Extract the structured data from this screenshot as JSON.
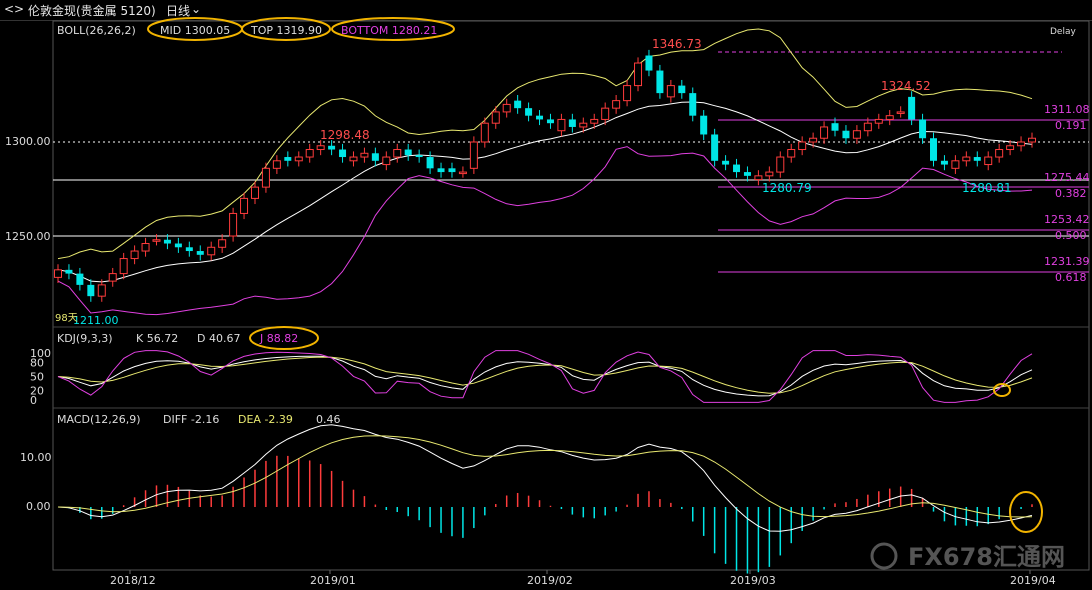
{
  "titlebar": {
    "symbol": "伦敦金现(贵金属 5120)",
    "period": "日线",
    "back_arrows": "<>",
    "delay": "Delay"
  },
  "boll": {
    "name": "BOLL(26,26,2)",
    "mid_label": "MID 1300.05",
    "top_label": "TOP 1319.90",
    "bottom_label": "BOTTOM 1280.21"
  },
  "kdj": {
    "name": "KDJ(9,3,3)",
    "k_label": "K 56.72",
    "d_label": "D 40.67",
    "j_label": "J 88.82"
  },
  "macd": {
    "name": "MACD(12,26,9)",
    "diff_label": "DIFF -2.16",
    "dea_label": "DEA -2.39",
    "macd_value": "0.46"
  },
  "fib_levels": [
    {
      "price": 1311.08,
      "ratio": "0.191"
    },
    {
      "price": 1275.44,
      "ratio": "0.382"
    },
    {
      "price": 1253.42,
      "ratio": "0.500"
    },
    {
      "price": 1231.39,
      "ratio": "0.618"
    }
  ],
  "annotations": {
    "high_1": "1346.73",
    "high_2": "1324.52",
    "high_3": "1298.48",
    "low_1": "1280.79",
    "low_2": "1280.81",
    "low_start": "1211.00",
    "days": "98天"
  },
  "watermark": "FX678汇通网",
  "chart_data": {
    "type": "candlestick",
    "dates": [
      "2018/12",
      "2019/01",
      "2019/02",
      "2019/03",
      "2019/04"
    ],
    "price_axis": {
      "ticks": [
        1250.0,
        1300.0
      ]
    },
    "kdj_axis": {
      "ticks": [
        100,
        80,
        50,
        20,
        0
      ]
    },
    "macd_axis": {
      "ticks": [
        10.0,
        0.0
      ]
    },
    "horizontal_lines": [
      1300.0,
      1280.21,
      1250.0
    ],
    "colors": {
      "up": "#ff3c3c",
      "down": "#00e6e6",
      "boll_mid": "#ffffff",
      "boll_upper": "#e8e870",
      "boll_lower": "#e040e0",
      "fib": "#e040e0",
      "kdj_k": "#ffffff",
      "kdj_d": "#e8e870",
      "kdj_j": "#e040e0"
    },
    "closes": [
      1232,
      1230,
      1224,
      1218,
      1224,
      1230,
      1238,
      1242,
      1246,
      1248,
      1246,
      1244,
      1242,
      1240,
      1244,
      1248,
      1262,
      1270,
      1276,
      1286,
      1290,
      1290,
      1292,
      1296,
      1298,
      1296,
      1292,
      1292,
      1294,
      1290,
      1292,
      1296,
      1293,
      1292,
      1286,
      1284,
      1284,
      1284,
      1300,
      1310,
      1316,
      1320,
      1318,
      1314,
      1312,
      1310,
      1312,
      1308,
      1310,
      1312,
      1318,
      1322,
      1330,
      1342,
      1338,
      1326,
      1330,
      1326,
      1314,
      1304,
      1290,
      1288,
      1284,
      1282,
      1282,
      1284,
      1292,
      1296,
      1300,
      1302,
      1308,
      1306,
      1302,
      1306,
      1310,
      1312,
      1314,
      1316,
      1312,
      1302,
      1290,
      1288,
      1290,
      1292,
      1290,
      1292,
      1296,
      1298,
      1300,
      1302
    ],
    "opens": [
      1228,
      1232,
      1230,
      1224,
      1218,
      1226,
      1230,
      1238,
      1242,
      1248,
      1248,
      1246,
      1244,
      1242,
      1240,
      1244,
      1250,
      1262,
      1270,
      1276,
      1286,
      1292,
      1290,
      1292,
      1296,
      1298,
      1296,
      1290,
      1292,
      1294,
      1288,
      1292,
      1296,
      1293,
      1292,
      1286,
      1286,
      1284,
      1286,
      1300,
      1310,
      1316,
      1322,
      1318,
      1314,
      1312,
      1306,
      1312,
      1308,
      1310,
      1312,
      1318,
      1322,
      1330,
      1346,
      1338,
      1324,
      1330,
      1326,
      1314,
      1304,
      1290,
      1288,
      1284,
      1280,
      1282,
      1284,
      1292,
      1296,
      1300,
      1302,
      1310,
      1306,
      1302,
      1306,
      1310,
      1312,
      1316,
      1324,
      1312,
      1302,
      1290,
      1286,
      1290,
      1292,
      1288,
      1292,
      1296,
      1298,
      1300
    ]
  }
}
